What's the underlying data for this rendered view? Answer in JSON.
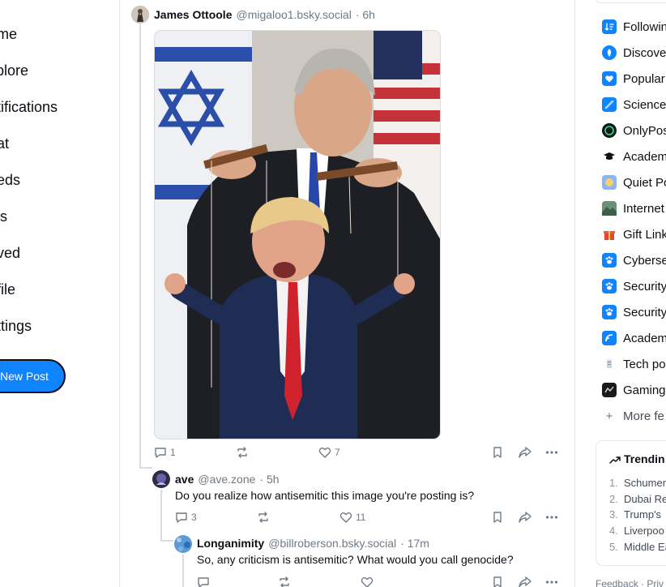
{
  "nav": {
    "items": [
      {
        "label": "ome"
      },
      {
        "label": "xplore"
      },
      {
        "label": "otifications"
      },
      {
        "label": "hat"
      },
      {
        "label": "eeds"
      },
      {
        "label": "sts"
      },
      {
        "label": "aved"
      },
      {
        "label": "ofile"
      },
      {
        "label": "ettings"
      }
    ],
    "new_post_label": "New Post"
  },
  "posts": [
    {
      "name": "James Ottoole",
      "handle": "@migaloo1.bsky.social",
      "time": "· 6h",
      "media_alt": "puppet illustration image",
      "actions": {
        "reply": "1",
        "repost": "",
        "like": "7"
      }
    },
    {
      "name": "ave",
      "handle": "@ave.zone",
      "time": "· 5h",
      "text": "Do you realize how antisemitic this image you're posting is?",
      "actions": {
        "reply": "3",
        "repost": "",
        "like": "11"
      }
    },
    {
      "name": "Longanimity",
      "handle": "@billroberson.bsky.social",
      "time": "· 17m",
      "text": "So, any criticism is antisemitic? What would you call genocide?",
      "actions": {
        "reply": "",
        "repost": "",
        "like": ""
      }
    }
  ],
  "feeds": [
    {
      "label": "Followin",
      "icon": "following-icon",
      "color": "#1083fe"
    },
    {
      "label": "Discove",
      "icon": "discover-icon",
      "color": "#1083fe"
    },
    {
      "label": "Popular",
      "icon": "heart-icon",
      "color": "#1083fe"
    },
    {
      "label": "Science",
      "icon": "science-icon",
      "color": "#1083fe"
    },
    {
      "label": "OnlyPos",
      "icon": "ring-icon",
      "color": "#0b1a14"
    },
    {
      "label": "Academ",
      "icon": "mortarboard-icon",
      "color": "#ffffff"
    },
    {
      "label": "Quiet Po",
      "icon": "quiet-icon",
      "color": "#8fb4f6"
    },
    {
      "label": "Internet",
      "icon": "landscape-icon",
      "color": "#6a8f7a"
    },
    {
      "label": "Gift Link",
      "icon": "gift-icon",
      "color": "#ffffff"
    },
    {
      "label": "Cyberse",
      "icon": "paw-icon",
      "color": "#1083fe"
    },
    {
      "label": "Security",
      "icon": "paw-icon",
      "color": "#1083fe"
    },
    {
      "label": "Security",
      "icon": "paw-icon",
      "color": "#1083fe"
    },
    {
      "label": "Academ",
      "icon": "rss-icon",
      "color": "#1083fe"
    },
    {
      "label": "Tech po",
      "icon": "tech-icon",
      "color": "#ffffff"
    },
    {
      "label": "Gaming",
      "icon": "gaming-icon",
      "color": "#1a1a1a"
    },
    {
      "label": "More fe",
      "icon": "plus-icon",
      "color": "#ffffff"
    }
  ],
  "trending": {
    "title": "Trendin",
    "items": [
      {
        "num": "1.",
        "label": "Schumer"
      },
      {
        "num": "2.",
        "label": "Dubai Re"
      },
      {
        "num": "3.",
        "label": "Trump's"
      },
      {
        "num": "4.",
        "label": "Liverpoo"
      },
      {
        "num": "5.",
        "label": "Middle Ea"
      }
    ]
  },
  "footer": {
    "label": "Feedback · Priv"
  },
  "colors": {
    "accent": "#1083fe",
    "muted": "#6f7a86",
    "border": "#e6eaef"
  }
}
